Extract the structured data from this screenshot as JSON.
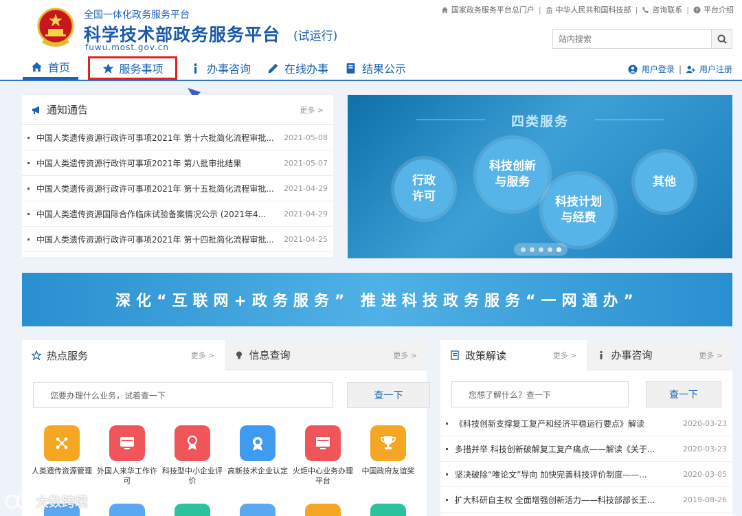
{
  "header": {
    "subtitle": "全国一体化政务服务平台",
    "title": "科学技术部政务服务平台",
    "trial": "(试运行)",
    "domain": "fuwu.most.gov.cn"
  },
  "toplinks": [
    {
      "label": "国家政务服务平台总门户",
      "icon": "home-icon"
    },
    {
      "label": "中华人民共和国科技部",
      "icon": "building-icon"
    },
    {
      "label": "咨询联系",
      "icon": "phone-icon"
    },
    {
      "label": "平台介绍",
      "icon": "question-icon"
    }
  ],
  "search": {
    "placeholder": "站内搜索"
  },
  "nav": [
    {
      "label": "首页",
      "icon": "home-icon"
    },
    {
      "label": "服务事项",
      "icon": "star-icon"
    },
    {
      "label": "办事咨询",
      "icon": "info-icon"
    },
    {
      "label": "在线办事",
      "icon": "pencil-icon"
    },
    {
      "label": "结果公示",
      "icon": "book-icon"
    }
  ],
  "user": {
    "login": "用户登录",
    "register": "用户注册"
  },
  "notice": {
    "title": "通知通告",
    "more": "更多 >",
    "items": [
      {
        "text": "中国人类遗传资源行政许可事项2021年 第十六批简化流程审批...",
        "date": "2021-05-08"
      },
      {
        "text": "中国人类遗传资源行政许可事项2021年 第八批审批结果",
        "date": "2021-05-07"
      },
      {
        "text": "中国人类遗传资源行政许可事项2021年 第十五批简化流程审批...",
        "date": "2021-04-29"
      },
      {
        "text": "中国人类遗传资源国际合作临床试验备案情况公示 (2021年4...",
        "date": "2021-04-29"
      },
      {
        "text": "中国人类遗传资源行政许可事项2021年 第十四批简化流程审批...",
        "date": "2021-04-25"
      }
    ]
  },
  "banner": {
    "title": "四类服务",
    "circles": [
      "行政\n许可",
      "科技创新\n与服务",
      "科技计划\n与经费",
      "其他"
    ]
  },
  "slogan": "深化“互联网+政务服务” 推进科技政务服务“一网通办”",
  "hot": {
    "tab1": "热点服务",
    "tab1_more": "更多 >",
    "tab2": "信息查询",
    "tab2_more": "更多 >",
    "placeholder": "您要办理什么业务，试着查一下",
    "button": "查一下",
    "services": [
      {
        "label": "人类遗传资源管理",
        "color": "#f5a623"
      },
      {
        "label": "外国人来华工作许可",
        "color": "#f0555a"
      },
      {
        "label": "科技型中小企业评价",
        "color": "#f0555a"
      },
      {
        "label": "高新技术企业认定",
        "color": "#3f9bf0"
      },
      {
        "label": "火炬中心业务办理平台",
        "color": "#f0555a"
      },
      {
        "label": "中国政府友谊奖",
        "color": "#f5a623"
      }
    ]
  },
  "policy": {
    "tab1": "政策解读",
    "tab1_more": "更多 >",
    "tab2": "办事咨询",
    "tab2_more": "更多 >",
    "placeholder": "您想了解什么？查一下",
    "button": "查一下",
    "items": [
      {
        "text": "《科技创新支撑复工复产和经济平稳运行要点》解读",
        "date": "2020-03-23"
      },
      {
        "text": "多措并举 科技创新破解复工复产痛点——解读《关于...",
        "date": "2020-03-23"
      },
      {
        "text": "坚决破除“唯论文”导向 加快完善科技评价制度——...",
        "date": "2020-03-05"
      },
      {
        "text": "扩大科研自主权 全面增强创新活力——科技部部长王...",
        "date": "2019-08-26"
      }
    ]
  },
  "watermark": "大数跨境"
}
